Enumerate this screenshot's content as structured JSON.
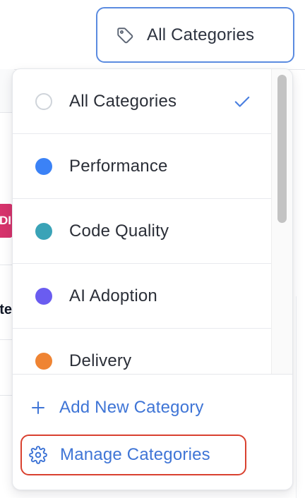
{
  "filter_button": {
    "label": "All Categories",
    "icon": "tag-icon"
  },
  "dropdown": {
    "items": [
      {
        "label": "All Categories",
        "dot_color": null,
        "selected": true
      },
      {
        "label": "Performance",
        "dot_color": "#3b82f6",
        "selected": false
      },
      {
        "label": "Code Quality",
        "dot_color": "#3aa3b7",
        "selected": false
      },
      {
        "label": "AI Adoption",
        "dot_color": "#6a5cf0",
        "selected": false
      },
      {
        "label": "Delivery",
        "dot_color": "#ef8433",
        "selected": false
      }
    ],
    "add_label": "Add New Category",
    "manage_label": "Manage Categories"
  },
  "background": {
    "badge_fragment": "DI",
    "column_fragment": "ate"
  },
  "colors": {
    "accent": "#3f75d6",
    "focus_border": "#5b8be0",
    "highlight_border": "#d9412f"
  }
}
